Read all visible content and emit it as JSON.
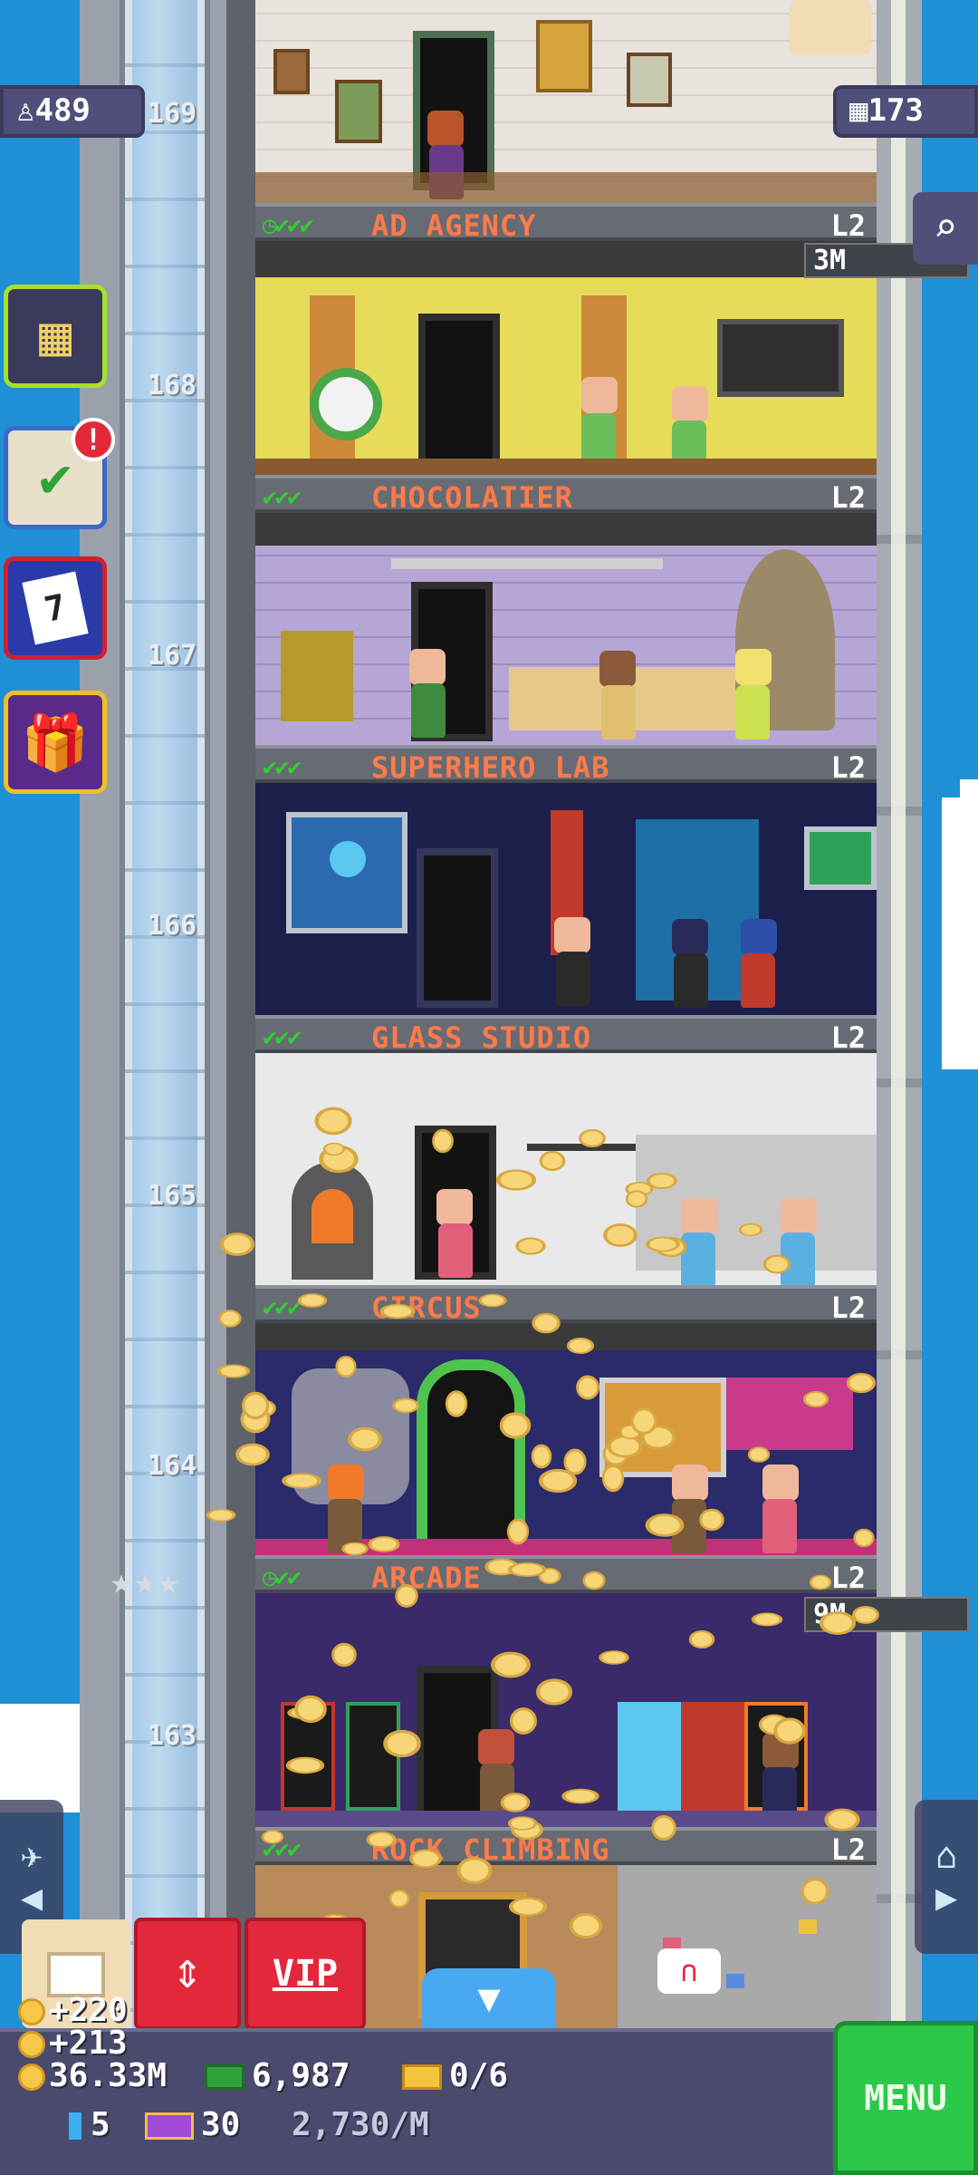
{
  "top_stats": {
    "population": "489",
    "floors": "173"
  },
  "floors": [
    {
      "number": "169",
      "name": "AD AGENCY",
      "level": "L2",
      "stock": "",
      "timer": true
    },
    {
      "number": "168",
      "name": "CHOCOLATIER",
      "level": "L2",
      "stock": "3M",
      "timer": false
    },
    {
      "number": "167",
      "name": "SUPERHERO LAB",
      "level": "L2",
      "stock": "",
      "timer": false
    },
    {
      "number": "166",
      "name": "GLASS STUDIO",
      "level": "L2",
      "stock": "",
      "timer": false
    },
    {
      "number": "165",
      "name": "CIRCUS",
      "level": "L2",
      "stock": "",
      "timer": false
    },
    {
      "number": "164",
      "name": "ARCADE",
      "level": "L2",
      "stock": "9M",
      "timer": true
    },
    {
      "number": "163",
      "name": "ROCK CLIMBING",
      "level": "L2",
      "stock": "",
      "timer": false
    }
  ],
  "side_menu": {
    "notification_badge": "!",
    "calendar_day": "7"
  },
  "stars": "★★★",
  "bottom": {
    "vip_label": "VIP",
    "coin_gain_1": "+220",
    "coin_gain_2": "+213",
    "coins": "36.33M",
    "bux": "6,987",
    "tickets": "0/6",
    "keys": "5",
    "vip_count": "30",
    "income_rate": "2,730/M",
    "menu_label": "MENU"
  },
  "colors": {
    "sky": "#1f8fd6",
    "label_text": "#ff7b4a",
    "menu_green": "#2cc84a",
    "vip_red": "#e3283b"
  }
}
